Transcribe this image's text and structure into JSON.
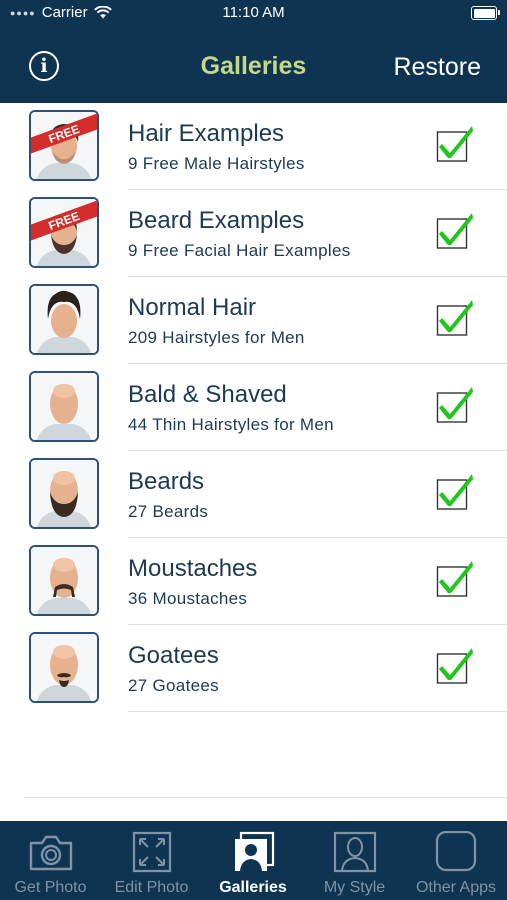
{
  "status": {
    "carrier": "Carrier",
    "time": "11:10 AM"
  },
  "header": {
    "title": "Galleries",
    "info_icon": "info-icon",
    "restore_label": "Restore"
  },
  "galleries": [
    {
      "title": "Hair Examples",
      "subtitle": "9 Free Male Hairstyles",
      "badge": "FREE",
      "checked": true
    },
    {
      "title": "Beard Examples",
      "subtitle": "9 Free Facial Hair Examples",
      "badge": "FREE",
      "checked": true
    },
    {
      "title": "Normal Hair",
      "subtitle": "209 Hairstyles for Men",
      "checked": true
    },
    {
      "title": "Bald & Shaved",
      "subtitle": "44 Thin Hairstyles for Men",
      "checked": true
    },
    {
      "title": "Beards",
      "subtitle": "27 Beards",
      "checked": true
    },
    {
      "title": "Moustaches",
      "subtitle": "36 Moustaches",
      "checked": true
    },
    {
      "title": "Goatees",
      "subtitle": "27 Goatees",
      "checked": true
    }
  ],
  "tabs": [
    {
      "label": "Get Photo",
      "icon": "camera-icon",
      "active": false
    },
    {
      "label": "Edit Photo",
      "icon": "resize-icon",
      "active": false
    },
    {
      "label": "Galleries",
      "icon": "galleries-icon",
      "active": true
    },
    {
      "label": "My Style",
      "icon": "person-icon",
      "active": false
    },
    {
      "label": "Other Apps",
      "icon": "apps-icon",
      "active": false
    }
  ],
  "colors": {
    "nav_bg": "#0f3451",
    "title": "#c7d78a",
    "check_green": "#22c51c",
    "text": "#1e3a52"
  }
}
